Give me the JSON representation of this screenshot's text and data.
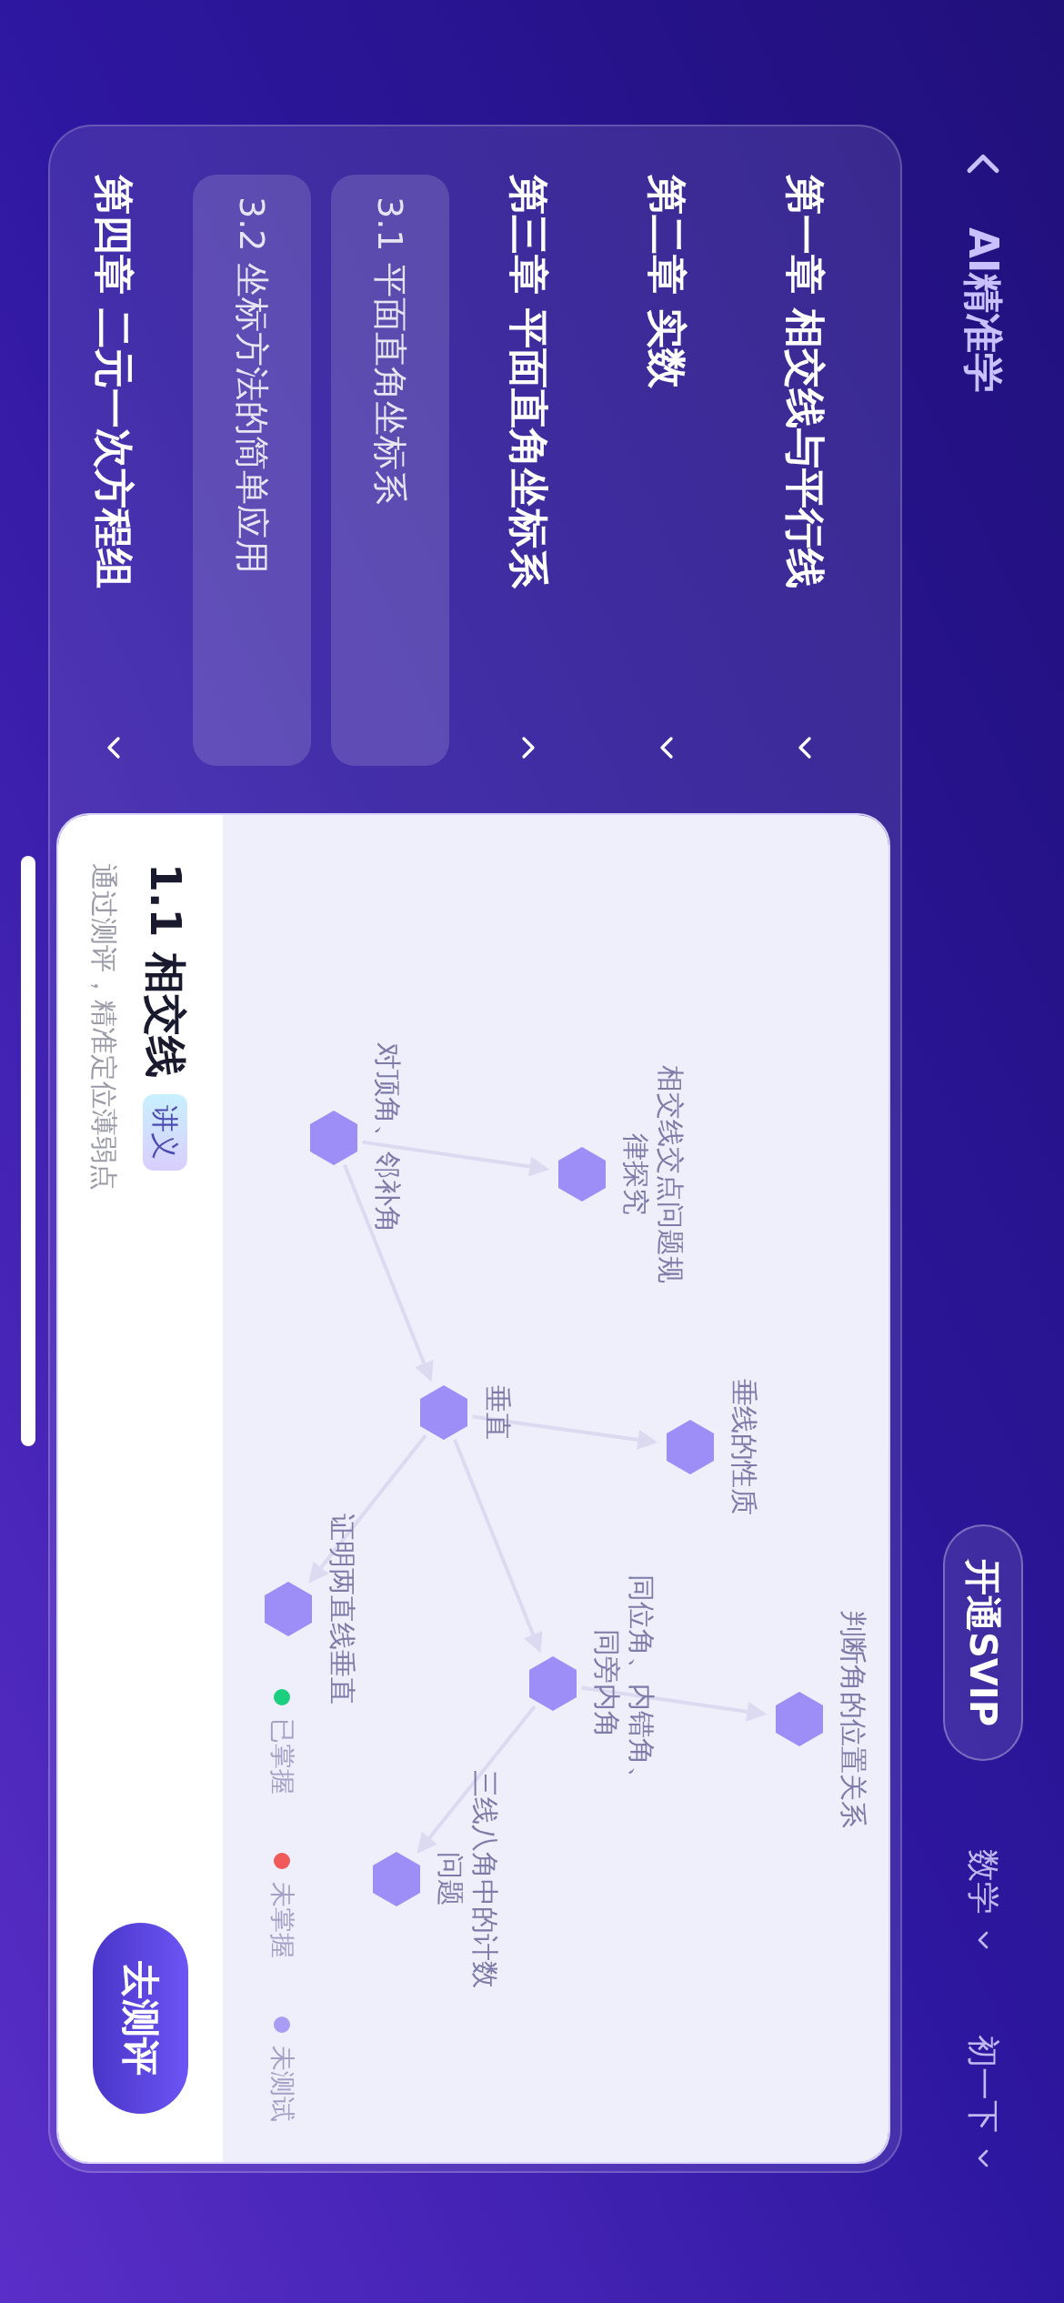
{
  "top_bar": {
    "title": "AI精准学",
    "vip_button": "开通SVIP",
    "subject_select": "数学",
    "grade_select": "初一下"
  },
  "chapters": [
    {
      "title": "第一章 相交线与平行线",
      "expanded": false
    },
    {
      "title": "第二章 实数",
      "expanded": false
    },
    {
      "title": "第三章 平面直角坐标系",
      "expanded": true,
      "children": [
        {
          "title": "3.1 平面直角坐标系"
        },
        {
          "title": "3.2 坐标方法的简单应用"
        }
      ]
    },
    {
      "title": "第四章 二元一次方程组",
      "expanded": false
    }
  ],
  "lesson": {
    "title": "1.1 相交线",
    "badge": "讲义",
    "subtitle": "通过测评，精准定位薄弱点",
    "button": "去测评"
  },
  "knowledge_map": {
    "root": {
      "label": "对顶角、邻补角",
      "color": "#9c8df7",
      "children": [
        {
          "label": "相交线交点问题规律探究",
          "color": "#9c8df7"
        },
        {
          "label": "垂直",
          "color": "#9c8df7",
          "children": [
            {
              "label": "垂线的性质",
              "color": "#9c8df7"
            },
            {
              "label": "证明两直线垂直",
              "color": "#9c8df7"
            },
            {
              "label": "同位角、内错角、同旁内角",
              "color": "#9c8df7",
              "children": [
                {
                  "label": "判断角的位置关系",
                  "color": "#9c8df7"
                },
                {
                  "label": "三线八角中的计数问题",
                  "color": "#9c8df7"
                }
              ]
            }
          ]
        }
      ]
    }
  },
  "legend": [
    {
      "label": "已掌握",
      "color": "#1ccf7e"
    },
    {
      "label": "未掌握",
      "color": "#f05a5a"
    },
    {
      "label": "未测试",
      "color": "#a99cf5"
    }
  ]
}
